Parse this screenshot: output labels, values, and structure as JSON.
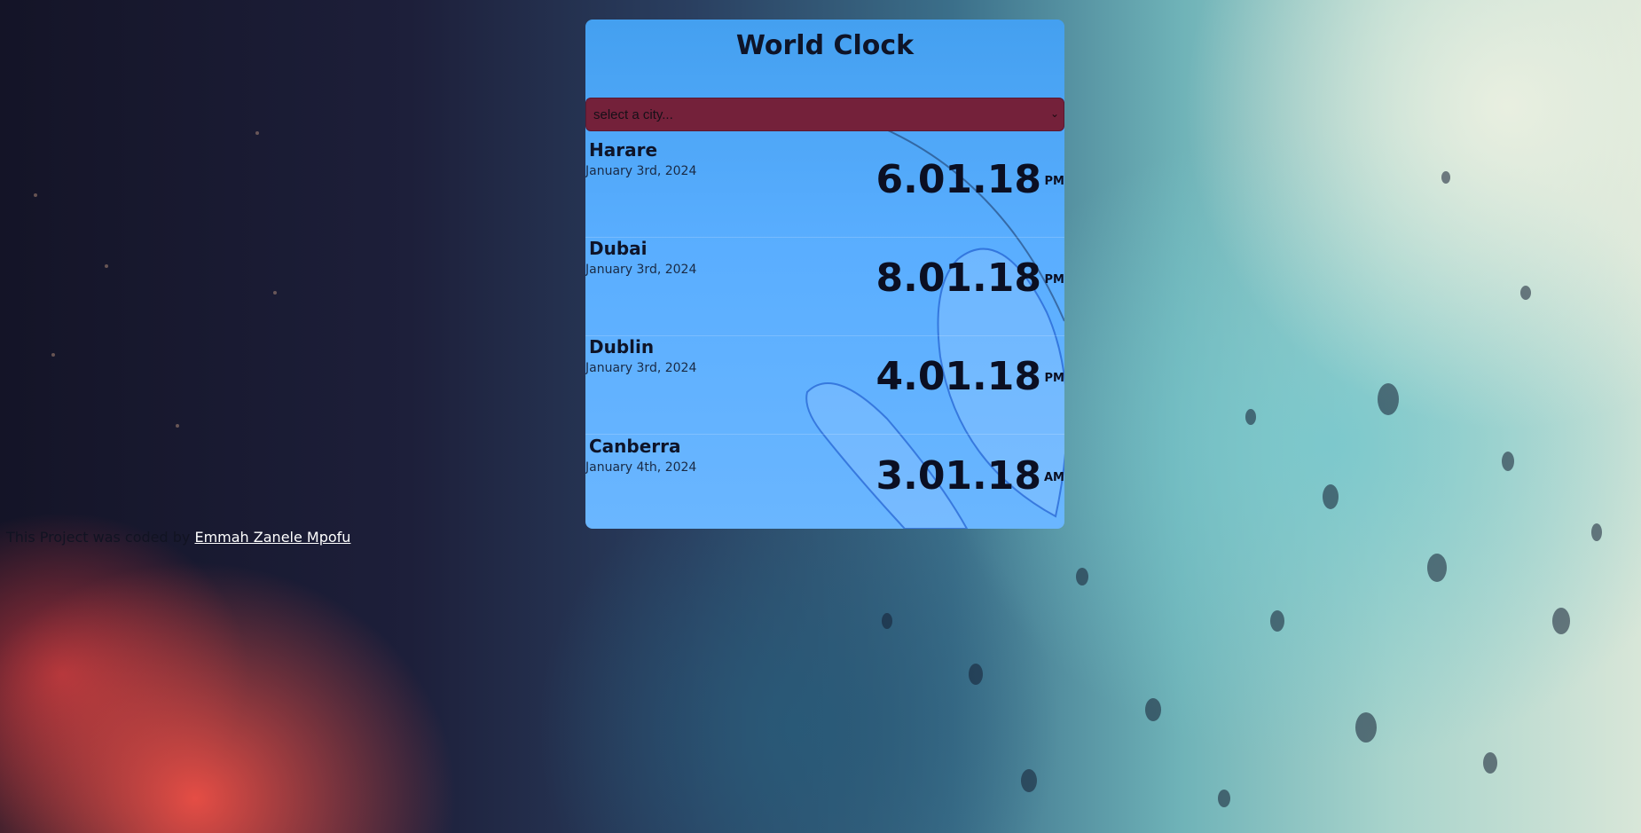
{
  "app": {
    "title": "World Clock"
  },
  "city_select": {
    "selected": "select a city..."
  },
  "cities": [
    {
      "name": "Harare",
      "date": "January 3rd, 2024",
      "time": "6.01.18",
      "ampm": "PM"
    },
    {
      "name": "Dubai",
      "date": "January 3rd, 2024",
      "time": "8.01.18",
      "ampm": "PM"
    },
    {
      "name": "Dublin",
      "date": "January 3rd, 2024",
      "time": "4.01.18",
      "ampm": "PM"
    },
    {
      "name": "Canberra",
      "date": "January 4th, 2024",
      "time": "3.01.18",
      "ampm": "AM"
    }
  ],
  "footer": {
    "text": "This Project was coded by ",
    "author_link": "Emmah Zanele Mpofu"
  },
  "colors": {
    "card_accent": "#5aaeff",
    "select_bg": "#74213a",
    "text_dark": "#0e1428"
  }
}
